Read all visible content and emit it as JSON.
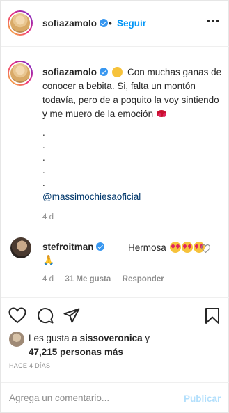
{
  "header": {
    "username": "sofiazamolo",
    "separator": "•",
    "follow_label": "Seguir"
  },
  "caption": {
    "username": "sofiazamolo",
    "text": "Con muchas ganas de conocer a bebita. Si, falta un montón todavía, pero de a poquito la voy sintiendo y me muero de la emoción",
    "dots": [
      ".",
      ".",
      ".",
      ".",
      "."
    ],
    "mention": "@massimochiesaoficial",
    "time": "4 d"
  },
  "comment": {
    "username": "stefroitman",
    "text": "Hermosa",
    "time": "4 d",
    "likes": "31 Me gusta",
    "reply_label": "Responder"
  },
  "likes": {
    "prefix": "Les gusta a",
    "user": "sissoveronica",
    "connector": "y",
    "others": "47,215 personas más"
  },
  "post_date": "HACE 4 DÍAS",
  "comment_box": {
    "placeholder": "Agrega un comentario...",
    "publish_label": "Publicar"
  },
  "colors": {
    "link_blue": "#0095f6",
    "verified_blue": "#3897f0",
    "publish_disabled": "#b2dffc",
    "muted_text": "#8e8e8e"
  }
}
